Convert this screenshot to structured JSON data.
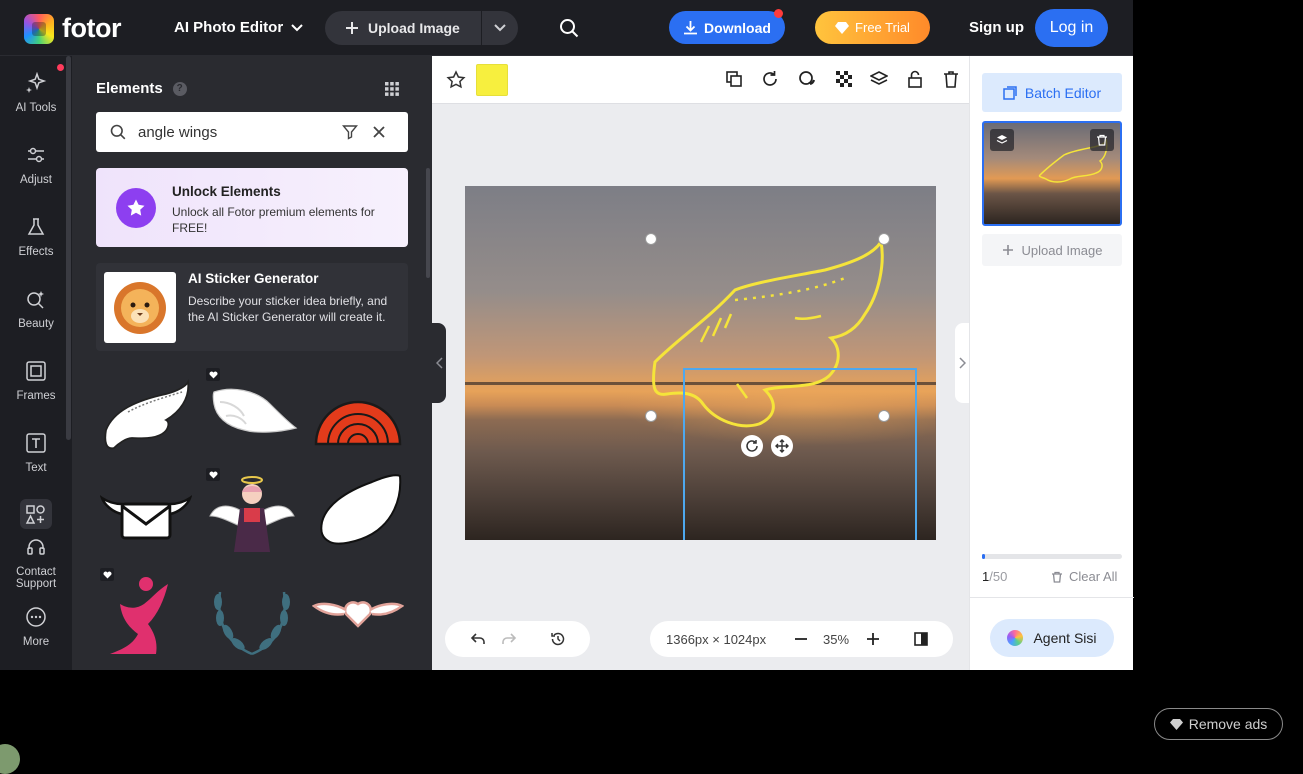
{
  "topbar": {
    "logo_text": "fotor",
    "menu_title": "AI Photo Editor",
    "upload_label": "Upload Image",
    "download_label": "Download",
    "free_trial_label": "Free Trial",
    "signup_label": "Sign up",
    "login_label": "Log in"
  },
  "rail": {
    "items": [
      {
        "label": "AI Tools",
        "icon": "sparkle-icon"
      },
      {
        "label": "Adjust",
        "icon": "sliders-icon"
      },
      {
        "label": "Effects",
        "icon": "flask-icon"
      },
      {
        "label": "Beauty",
        "icon": "beauty-icon"
      },
      {
        "label": "Frames",
        "icon": "frame-icon"
      },
      {
        "label": "Text",
        "icon": "text-icon"
      },
      {
        "label": "",
        "icon": "elements-icon"
      },
      {
        "label": "Contact Support",
        "icon": "headset-icon"
      },
      {
        "label": "More",
        "icon": "more-icon"
      }
    ]
  },
  "panel": {
    "title": "Elements",
    "search_value": "angle wings",
    "unlock": {
      "title": "Unlock Elements",
      "subtitle": "Unlock all Fotor premium elements for FREE!"
    },
    "sticker": {
      "title": "AI Sticker Generator",
      "subtitle": "Describe your sticker idea briefly, and the AI Sticker Generator will create it."
    }
  },
  "canvas": {
    "swatch_color": "#f7ef3e",
    "dimensions": "1366px × 1024px",
    "zoom": "35%"
  },
  "right_panel": {
    "batch_label": "Batch Editor",
    "upload_label": "Upload Image",
    "count_current": "1",
    "count_total": "/50",
    "progress_fraction": 0.02,
    "clear_label": "Clear All",
    "agent_label": "Agent Sisi"
  },
  "ads": {
    "remove_label": "Remove ads"
  },
  "colors": {
    "accent": "#2b6ff2",
    "wing": "#f5e43a",
    "selection": "#4ea8ee"
  }
}
